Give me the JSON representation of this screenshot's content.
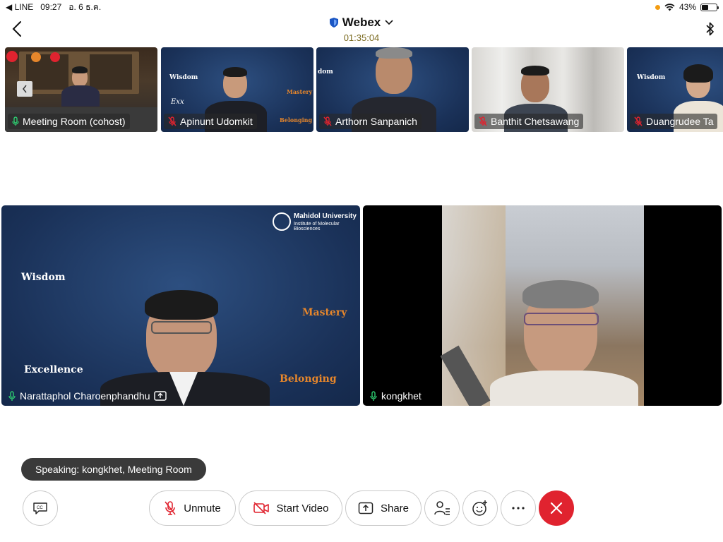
{
  "status_bar": {
    "back_app": "◀ LINE",
    "time": "09:27",
    "date": "อ. 6 ธ.ค.",
    "battery": "43%",
    "battery_level": 0.43
  },
  "header": {
    "title": "Webex",
    "timer": "01:35:04"
  },
  "thumbnails": [
    {
      "name": "Meeting Room (cohost)",
      "mic": "on"
    },
    {
      "name": "Apinunt Udomkit",
      "mic": "muted"
    },
    {
      "name": "Arthorn Sanpanich",
      "mic": "muted"
    },
    {
      "name": "Banthit Chetsawang",
      "mic": "muted"
    },
    {
      "name": "Duangrudee Ta",
      "mic": "muted"
    }
  ],
  "main_tiles": [
    {
      "name": "Narattaphol Charoenphandhu",
      "mic": "on",
      "background_labels": {
        "institution": "Mahidol University",
        "institution_sub": "Institute of Molecular Biosciences",
        "wisdom": "Wisdom",
        "mastery": "Mastery",
        "excellence": "Excellence",
        "belonging": "Belonging"
      }
    },
    {
      "name": "kongkhet",
      "mic": "on"
    }
  ],
  "speaking_banner": "Speaking: kongkhet, Meeting Room",
  "controls": {
    "unmute_label": "Unmute",
    "start_video_label": "Start Video",
    "share_label": "Share"
  },
  "colors": {
    "end_call": "#e0232f",
    "mute_red": "#e0232f",
    "mic_green": "#2ecc71",
    "timer": "#7a6a1f"
  }
}
